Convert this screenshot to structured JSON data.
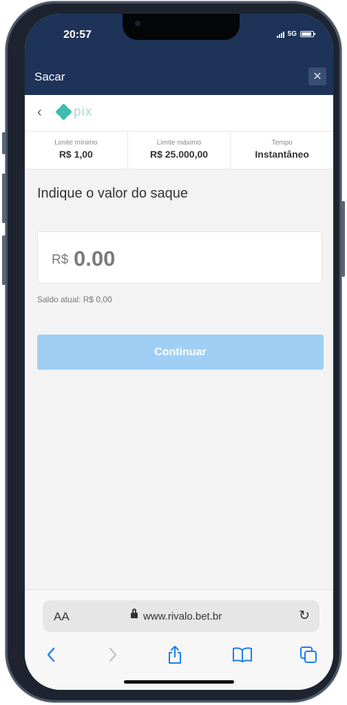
{
  "status_bar": {
    "time": "20:57",
    "network": "5G"
  },
  "modal": {
    "title": "Sacar",
    "close_glyph": "✕"
  },
  "payment_method": {
    "logo_text": "pix",
    "back_glyph": "‹"
  },
  "limits": [
    {
      "label": "Limite mínimo",
      "value": "R$ 1,00"
    },
    {
      "label": "Limite máximo",
      "value": "R$ 25.000,00"
    },
    {
      "label": "Tempo",
      "value": "Instantâneo"
    }
  ],
  "withdraw": {
    "prompt": "Indique o valor do saque",
    "currency": "R$",
    "amount": "0.00",
    "balance": "Saldo atual: R$ 0,00",
    "continue_label": "Continuar"
  },
  "browser": {
    "text_size_label": "AA",
    "url": "www.rivalo.bet.br"
  },
  "colors": {
    "header": "#1e3358",
    "pix_teal": "#3fbcad",
    "button_disabled": "#9fcff5"
  }
}
